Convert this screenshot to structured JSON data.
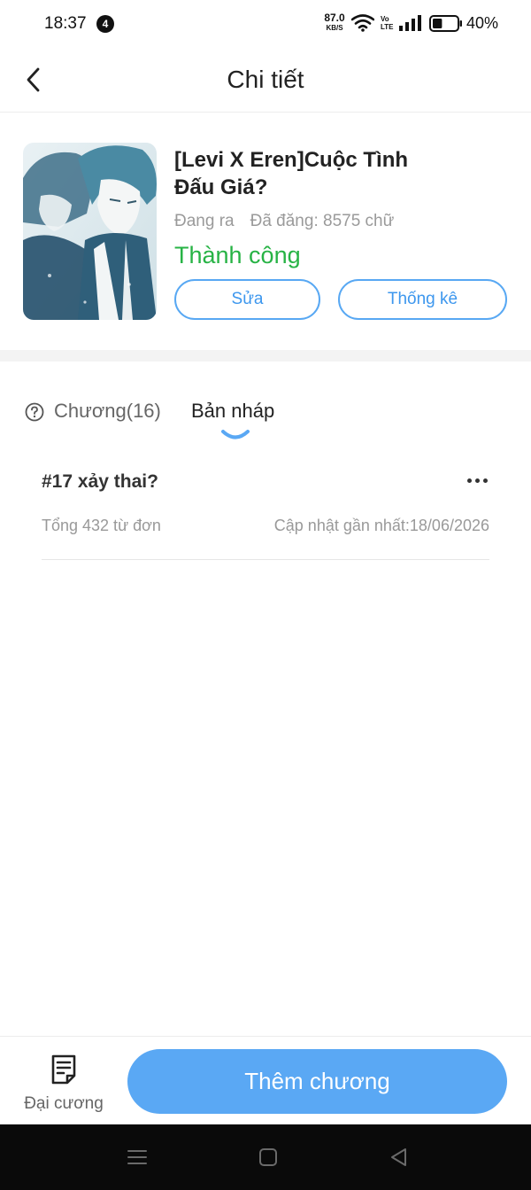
{
  "status_bar": {
    "time": "18:37",
    "notification_count": "4",
    "net_speed_value": "87.0",
    "net_speed_unit": "KB/S",
    "volte_top": "Vo",
    "volte_bottom": "LTE",
    "battery_percent": "40%",
    "battery_level": 0.4,
    "icons": [
      "wifi-icon",
      "volte-icon",
      "signal-icon",
      "battery-icon"
    ]
  },
  "header": {
    "title": "Chi tiết",
    "back_icon": "chevron-left-icon"
  },
  "book": {
    "title": "[Levi X Eren]Cuộc Tình Đấu Giá?",
    "status": "Đang ra",
    "published": "Đã đăng: 8575 chữ",
    "result": "Thành công",
    "edit_label": "Sửa",
    "stats_label": "Thống kê"
  },
  "tabs": {
    "help_icon": "question-circle-icon",
    "chapters_label": "Chương(16)",
    "drafts_label": "Bản nháp",
    "active": "drafts"
  },
  "drafts": [
    {
      "title": "#17 xảy thai?",
      "word_count": "Tổng 432 từ đơn",
      "updated": "Cập nhật gần nhất:18/06/2026"
    }
  ],
  "bottom_bar": {
    "outline_label": "Đại cương",
    "outline_icon": "document-list-icon",
    "add_chapter_label": "Thêm chương"
  },
  "colors": {
    "accent": "#5aa8f4",
    "success": "#27b345",
    "muted_text": "#999999",
    "nav_bar": "#0a0a0a"
  }
}
